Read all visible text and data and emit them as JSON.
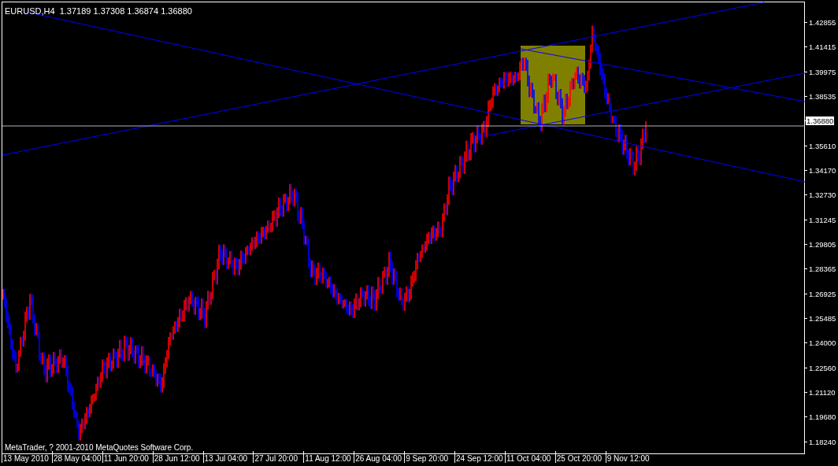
{
  "chart": {
    "header": "EURUSD,H4  1.37189 1.37308 1.36874 1.36880",
    "copyright": "MetaTrader, ? 2001-2010 MetaQuotes Software Corp.",
    "price_axis": [
      {
        "kind": "tick",
        "label": "1.42855"
      },
      {
        "kind": "tick",
        "label": "1.41415"
      },
      {
        "kind": "tick",
        "label": "1.39975"
      },
      {
        "kind": "tick",
        "label": "1.38535"
      },
      {
        "kind": "current",
        "label": "1.36880"
      },
      {
        "kind": "tick",
        "label": "1.35610"
      },
      {
        "kind": "tick",
        "label": "1.34170"
      },
      {
        "kind": "tick",
        "label": "1.32730"
      },
      {
        "kind": "tick",
        "label": "1.31245"
      },
      {
        "kind": "tick",
        "label": "1.29805"
      },
      {
        "kind": "tick",
        "label": "1.28365"
      },
      {
        "kind": "tick",
        "label": "1.26925"
      },
      {
        "kind": "tick",
        "label": "1.25485"
      },
      {
        "kind": "tick",
        "label": "1.24000"
      },
      {
        "kind": "tick",
        "label": "1.22560"
      },
      {
        "kind": "tick",
        "label": "1.21120"
      },
      {
        "kind": "tick",
        "label": "1.19680"
      },
      {
        "kind": "tick",
        "label": "1.18240"
      }
    ],
    "time_axis": [
      "13 May 2010",
      "28 May 04:00",
      "11 Jun 20:00",
      "28 Jun 12:00",
      "13 Jul 04:00",
      "27 Jul 20:00",
      "11 Aug 12:00",
      "26 Aug 04:00",
      "9 Sep 20:00",
      "24 Sep 12:00",
      "11 Oct 04:00",
      "25 Oct 20:00",
      "9 Nov 12:00"
    ]
  }
}
